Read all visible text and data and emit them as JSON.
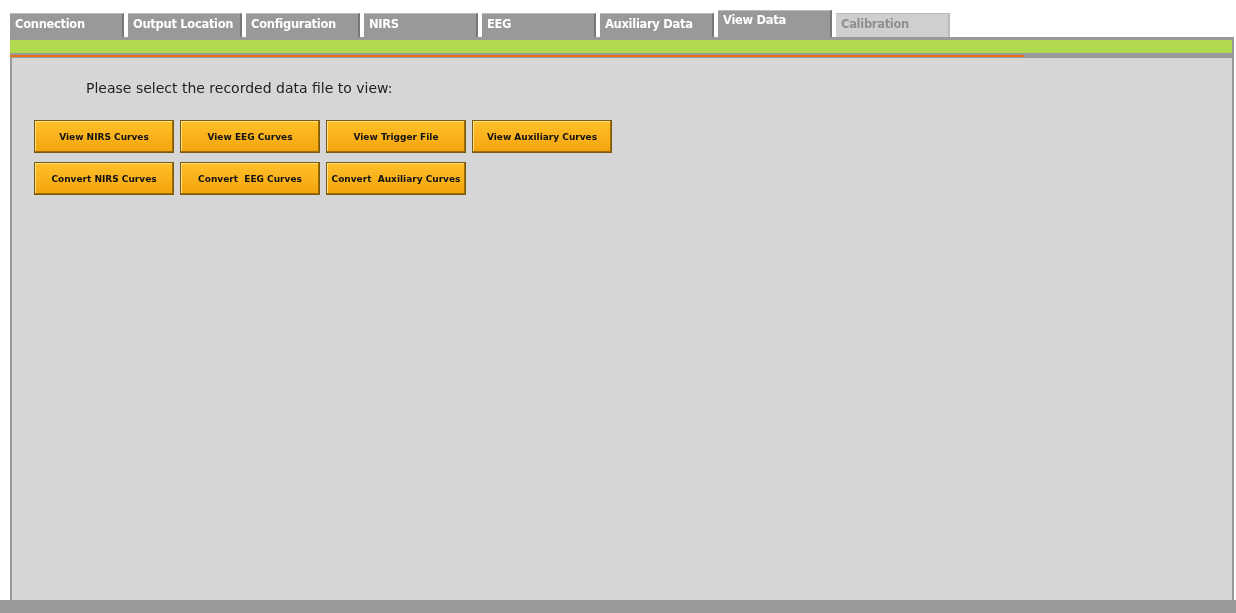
{
  "tabs": [
    {
      "label": "Connection",
      "selected": false,
      "disabled": false
    },
    {
      "label": "Output Location",
      "selected": false,
      "disabled": false
    },
    {
      "label": "Configuration",
      "selected": false,
      "disabled": false
    },
    {
      "label": "NIRS",
      "selected": false,
      "disabled": false
    },
    {
      "label": "EEG",
      "selected": false,
      "disabled": false
    },
    {
      "label": "Auxiliary Data",
      "selected": false,
      "disabled": false
    },
    {
      "label": "View Data",
      "selected": true,
      "disabled": false
    },
    {
      "label": "Calibration",
      "selected": false,
      "disabled": true
    }
  ],
  "progress": {
    "level": 0.83
  },
  "prompt": "Please select the recorded data file to view:",
  "button_rows": [
    [
      "View NIRS Curves",
      "View EEG Curves",
      "View Trigger File",
      "View Auxiliary Curves"
    ],
    [
      "Convert NIRS Curves",
      "Convert  EEG Curves",
      "Convert  Auxiliary Curves"
    ]
  ]
}
